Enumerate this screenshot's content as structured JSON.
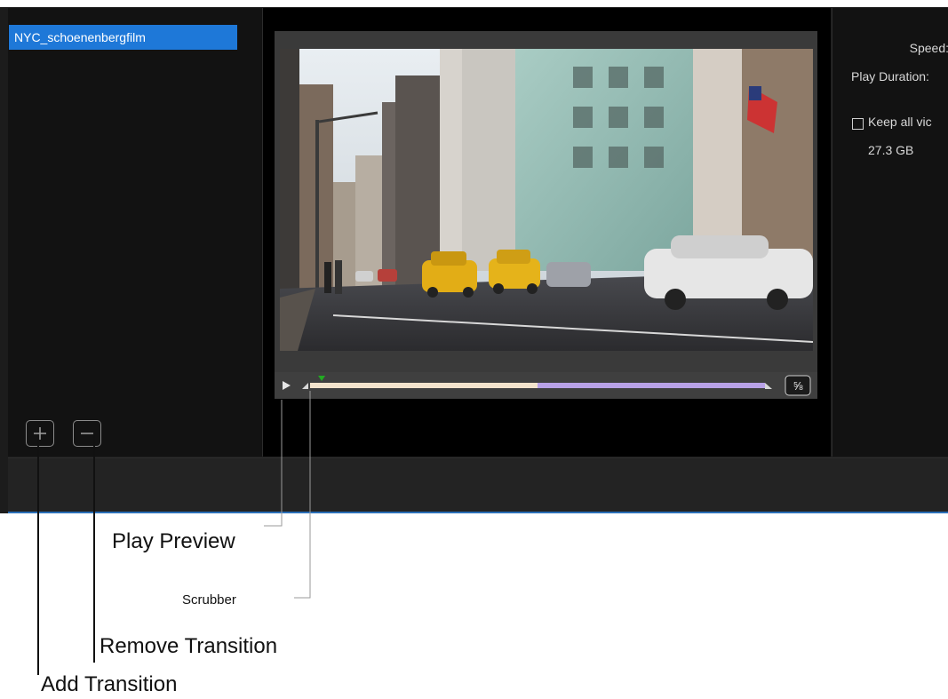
{
  "transitions_panel": {
    "items": [
      {
        "label": "NYC_schoenenbergfilm",
        "selected": true
      }
    ],
    "add_icon": "plus-icon",
    "remove_icon": "minus-icon"
  },
  "preview": {
    "timeline": {
      "progress": 0.045,
      "segment_split": 0.5,
      "segment_colors": {
        "first": "#f3e3cc",
        "second": "#b9a2e8"
      },
      "marker_color": "#22aa22",
      "end_button_glyph": "⅝"
    }
  },
  "properties": {
    "speed_label": "Speed:",
    "play_duration_label": "Play Duration:",
    "keep_all_label": "Keep all vic",
    "keep_all_checked": false,
    "size_value": "27.3 GB"
  },
  "annotations": {
    "play_preview": "Play Preview",
    "scrubber": "Scrubber",
    "remove_transition": "Remove Transition",
    "add_transition": "Add Transition"
  },
  "colors": {
    "selection": "#1e78d8",
    "app_background": "#1c1c1c",
    "status_line": "#2a6fb8"
  }
}
